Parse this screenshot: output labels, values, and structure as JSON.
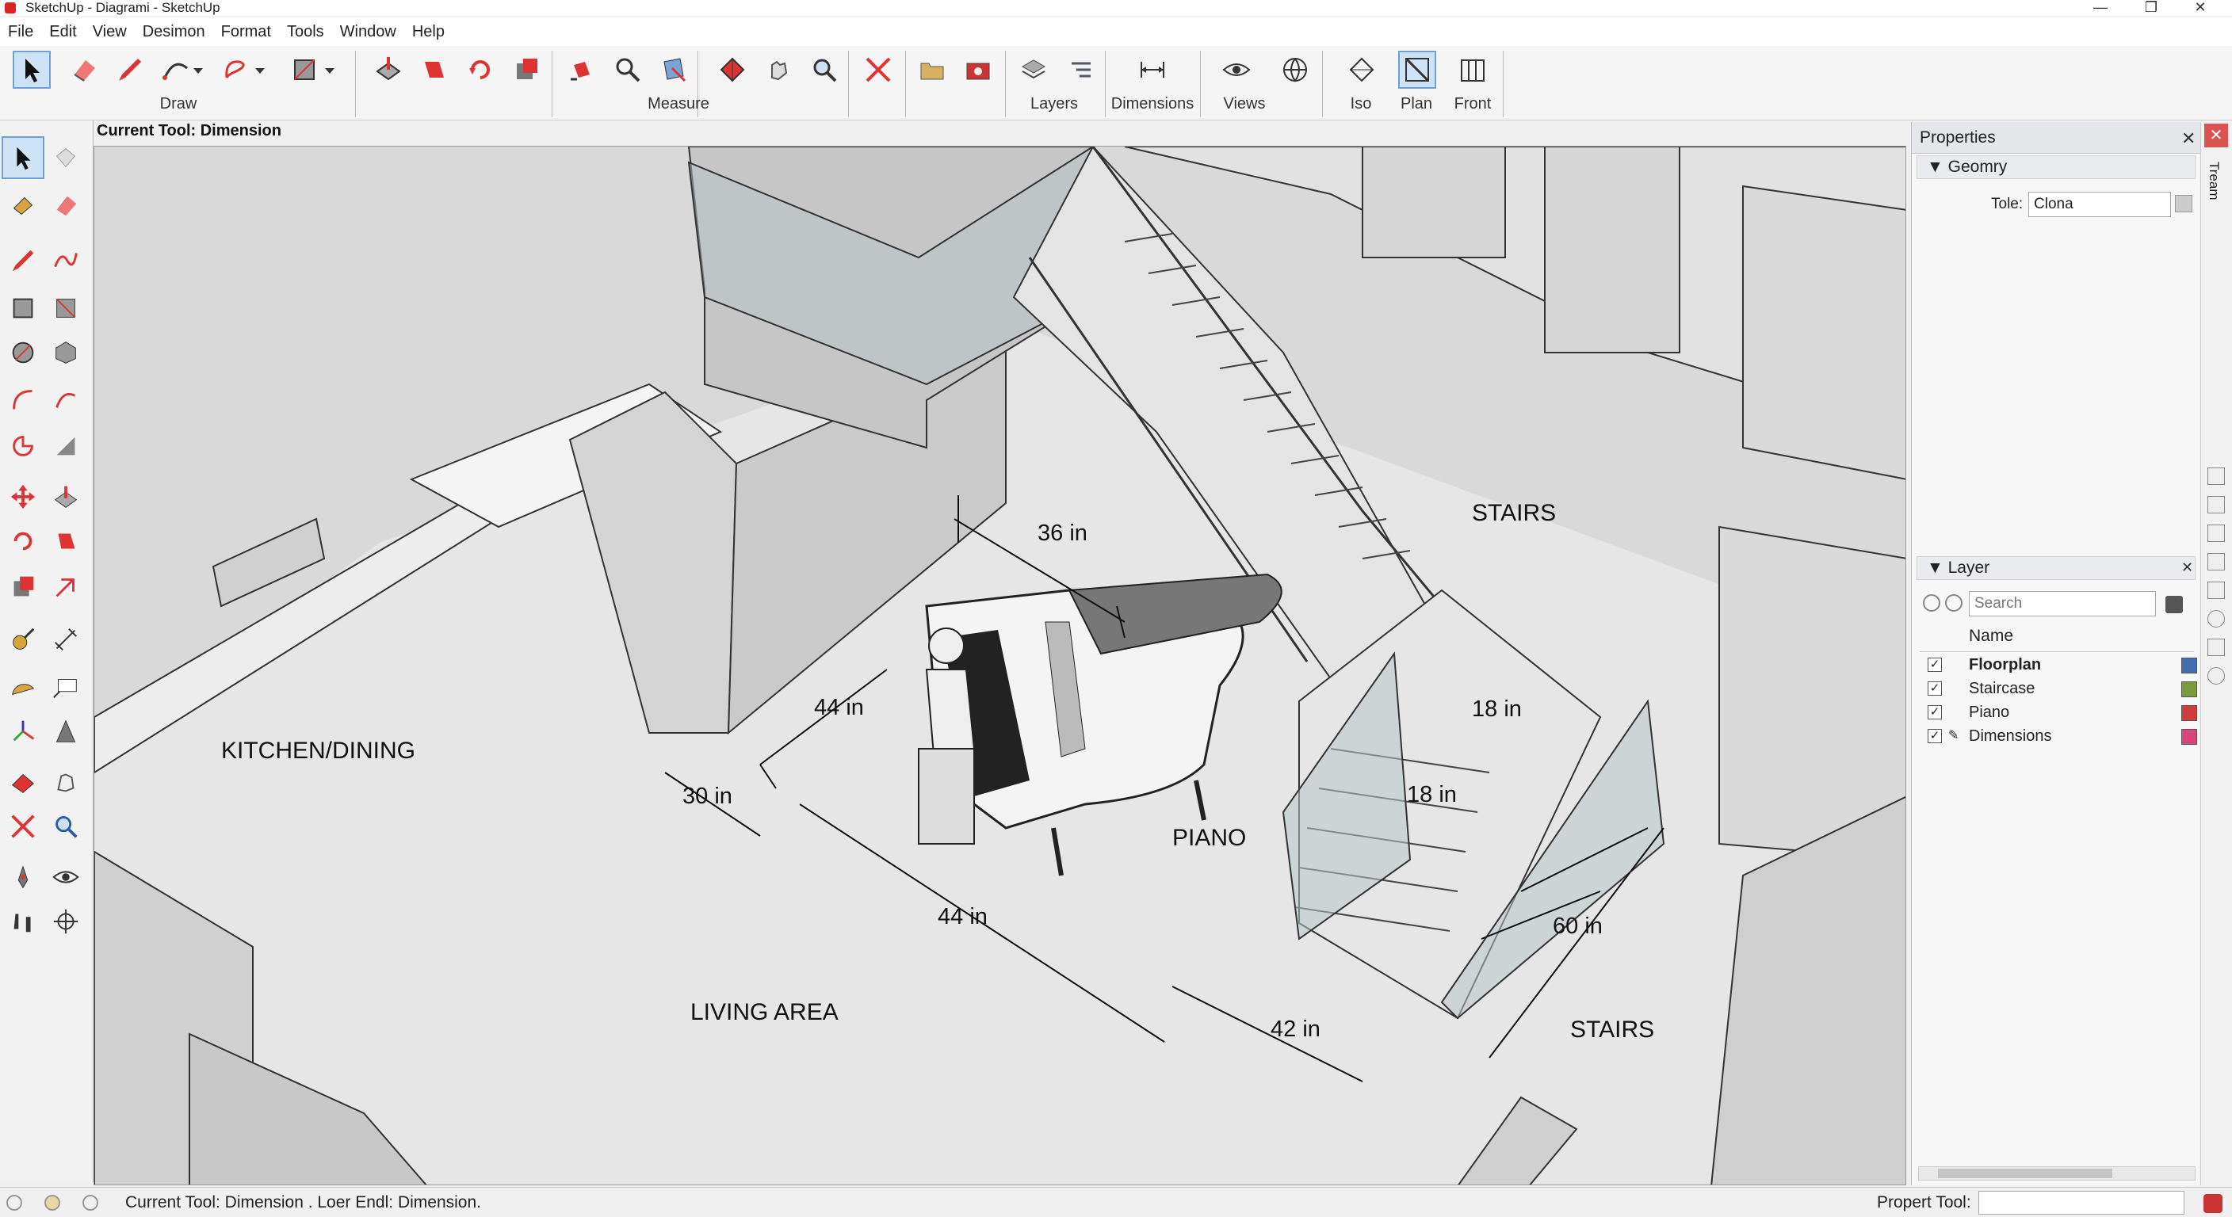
{
  "window": {
    "title": "SketchUp - Diagrami - SketchUp",
    "minimize": "—",
    "restore": "❐",
    "close": "✕"
  },
  "menu": [
    "File",
    "Edit",
    "View",
    "Desimon",
    "Format",
    "Tools",
    "Window",
    "Help"
  ],
  "toolbar": {
    "groups": {
      "draw": "Draw",
      "measure": "Measure",
      "layers": "Layers",
      "dimensions": "Dimensions",
      "views": "Views",
      "iso": "Iso",
      "plan": "Plan",
      "front": "Front"
    },
    "active_view": "Plan"
  },
  "viewport": {
    "current_tool": "Current Tool: Dimension",
    "labels": {
      "kitchen": "KITCHEN/DINING",
      "living": "LIVING AREA",
      "piano": "PIANO",
      "stairs_upper": "STAIRS",
      "stairs_lower": "STAIRS"
    },
    "dims": {
      "d36": "36 in",
      "d44a": "44 in",
      "d30": "30 in",
      "d44b": "44 in",
      "d42": "42 in",
      "d18a": "18 in",
      "d18b": "18 in",
      "d60": "60 in"
    }
  },
  "properties": {
    "title": "Properties",
    "geometry_header": "Geomry",
    "tole_label": "Tole:",
    "tole_value": "Clona",
    "layer_header": "Layer",
    "search_placeholder": "Search",
    "name_col": "Name",
    "layers": [
      {
        "name": "Floorplan",
        "checked": true,
        "color": "#3f6fb0",
        "bold": true
      },
      {
        "name": "Staircase",
        "checked": true,
        "color": "#7a9a3c",
        "bold": false
      },
      {
        "name": "Piano",
        "checked": true,
        "color": "#d23b3b",
        "bold": false
      },
      {
        "name": "Dimensions",
        "checked": true,
        "color": "#d8457a",
        "bold": false
      }
    ]
  },
  "side_tab": "Tream",
  "status": {
    "left": "Current Tool: Dimension . Loer Endl: Dimension.",
    "right_label": "Propert Tool:"
  }
}
